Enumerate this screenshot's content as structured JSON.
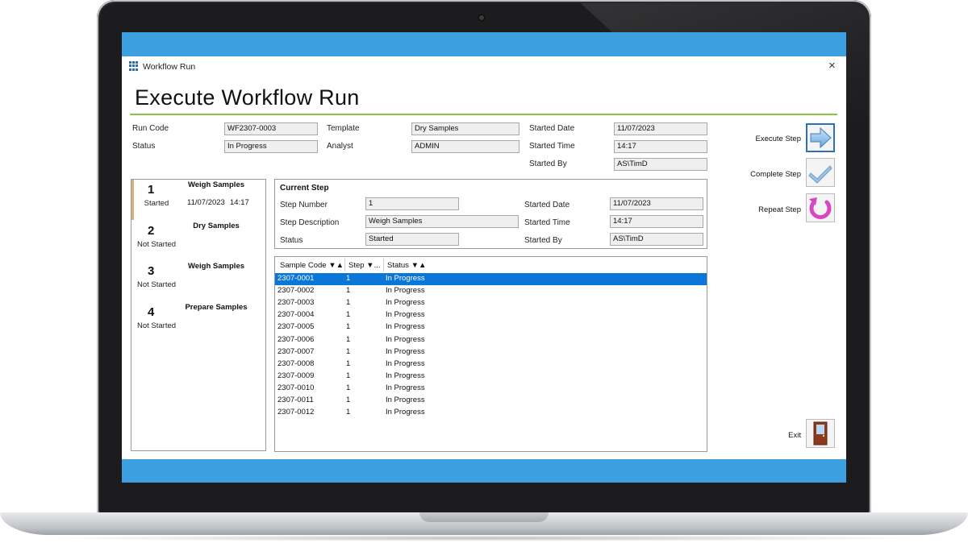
{
  "window": {
    "title": "Workflow Run",
    "close_glyph": "×"
  },
  "page": {
    "heading": "Execute Workflow Run"
  },
  "header": {
    "run_code_label": "Run Code",
    "run_code": "WF2307-0003",
    "status_label": "Status",
    "status": "In Progress",
    "template_label": "Template",
    "template": "Dry Samples",
    "analyst_label": "Analyst",
    "analyst": "ADMIN",
    "started_date_label": "Started Date",
    "started_date": "11/07/2023",
    "started_time_label": "Started Time",
    "started_time": "14:17",
    "started_by_label": "Started By",
    "started_by": "AS\\TimD"
  },
  "steps": [
    {
      "number": "1",
      "name": "Weigh Samples",
      "state": "Started",
      "date": "11/07/2023",
      "time": "14:17"
    },
    {
      "number": "2",
      "name": "Dry Samples",
      "state": "Not Started"
    },
    {
      "number": "3",
      "name": "Weigh Samples",
      "state": "Not Started"
    },
    {
      "number": "4",
      "name": "Prepare Samples",
      "state": "Not Started"
    }
  ],
  "current_step": {
    "title": "Current Step",
    "step_number_label": "Step Number",
    "step_number": "1",
    "step_description_label": "Step Description",
    "step_description": "Weigh Samples",
    "status_label": "Status",
    "status": "Started",
    "started_date_label": "Started Date",
    "started_date": "11/07/2023",
    "started_time_label": "Started Time",
    "started_time": "14:17",
    "started_by_label": "Started By",
    "started_by": "AS\\TimD"
  },
  "grid": {
    "columns": [
      "Sample Code ▼▲",
      "Step ▼...",
      "Status ▼▲"
    ],
    "rows": [
      [
        "2307-0001",
        "1",
        "In Progress"
      ],
      [
        "2307-0002",
        "1",
        "In Progress"
      ],
      [
        "2307-0003",
        "1",
        "In Progress"
      ],
      [
        "2307-0004",
        "1",
        "In Progress"
      ],
      [
        "2307-0005",
        "1",
        "In Progress"
      ],
      [
        "2307-0006",
        "1",
        "In Progress"
      ],
      [
        "2307-0007",
        "1",
        "In Progress"
      ],
      [
        "2307-0008",
        "1",
        "In Progress"
      ],
      [
        "2307-0009",
        "1",
        "In Progress"
      ],
      [
        "2307-0010",
        "1",
        "In Progress"
      ],
      [
        "2307-0011",
        "1",
        "In Progress"
      ],
      [
        "2307-0012",
        "1",
        "In Progress"
      ]
    ],
    "selected_row": 0
  },
  "actions": {
    "execute_step": "Execute Step",
    "complete_step": "Complete Step",
    "repeat_step": "Repeat Step",
    "exit": "Exit"
  },
  "icons": {
    "execute": "arrow-right-icon",
    "complete": "checkmark-icon",
    "repeat": "circular-arrow-icon",
    "exit": "door-icon"
  },
  "colors": {
    "accent_bar": "#3b9fe0",
    "heading_rule": "#8cc63f",
    "selection": "#0a76d8"
  }
}
